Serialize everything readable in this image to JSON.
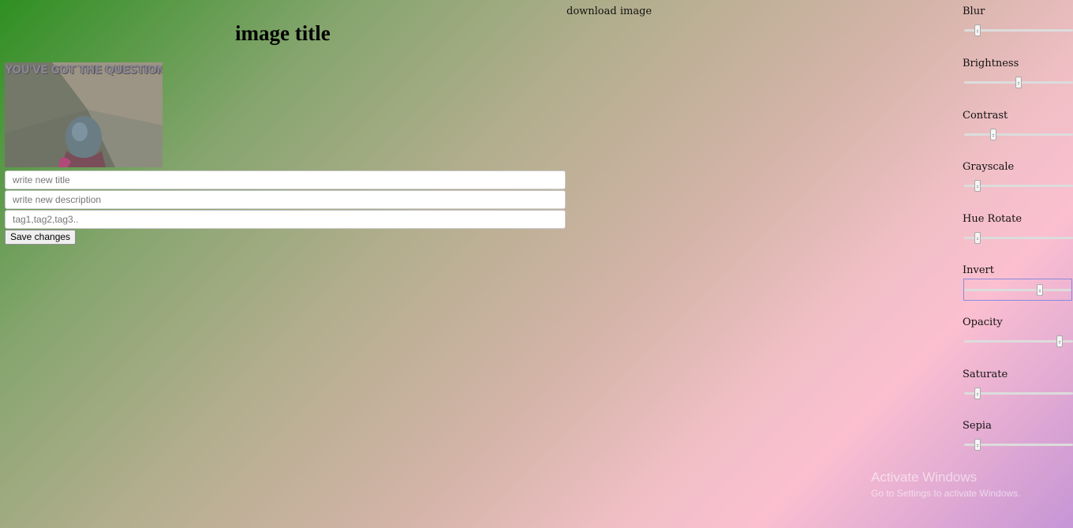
{
  "header": {
    "download_label": "download image",
    "title": "image title"
  },
  "image": {
    "caption": "YOU'VE GOT THE QUESTIONS"
  },
  "form": {
    "title_placeholder": "write new title",
    "description_placeholder": "write new description",
    "tags_placeholder": "tag1,tag2,tag3..",
    "save_label": "Save changes"
  },
  "filters": [
    {
      "label": "Blur",
      "value": 0.1
    },
    {
      "label": "Brightness",
      "value": 0.5
    },
    {
      "label": "Contrast",
      "value": 0.25
    },
    {
      "label": "Grayscale",
      "value": 0.1
    },
    {
      "label": "Hue Rotate",
      "value": 0.1
    },
    {
      "label": "Invert",
      "value": 0.72
    },
    {
      "label": "Opacity",
      "value": 0.9
    },
    {
      "label": "Saturate",
      "value": 0.1
    },
    {
      "label": "Sepia",
      "value": 0.1
    }
  ],
  "watermark": {
    "title": "Activate Windows",
    "subtitle": "Go to Settings to activate Windows."
  }
}
